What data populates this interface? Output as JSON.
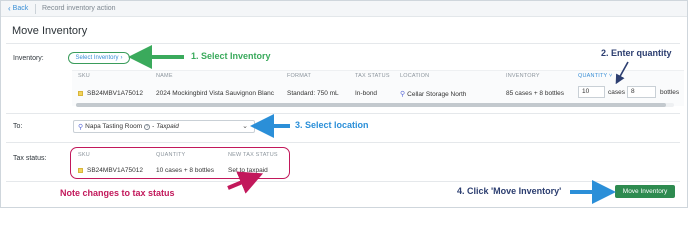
{
  "breadcrumb": {
    "back_label": "Back",
    "current": "Record inventory action"
  },
  "page": {
    "title": "Move Inventory"
  },
  "inventory": {
    "label": "Inventory:",
    "select_button": "Select Inventory",
    "columns": [
      "SKU",
      "NAME",
      "FORMAT",
      "TAX STATUS",
      "LOCATION",
      "INVENTORY",
      "QUANTITY"
    ],
    "row": {
      "sku": "SB24MBV1A75012",
      "name": "2024 Mockingbird Vista Sauvignon Blanc",
      "format": "Standard: 750 mL",
      "tax_status": "In-bond",
      "location": "Cellar Storage North",
      "inventory": "85 cases + 8 bottles",
      "quantity_cases": "10",
      "cases_unit": "cases",
      "quantity_bottles": "8",
      "bottles_unit": "bottles"
    }
  },
  "to": {
    "label": "To:",
    "location_name": "Napa Tasting Room",
    "separator": "-",
    "location_status": "Taxpaid"
  },
  "tax_status": {
    "label": "Tax status:",
    "columns": [
      "SKU",
      "QUANTITY",
      "NEW TAX STATUS"
    ],
    "row": {
      "sku": "SB24MBV1A75012",
      "quantity": "10 cases + 8 bottles",
      "new_status": "Set to taxpaid"
    }
  },
  "actions": {
    "move_button": "Move Inventory"
  },
  "annotations": {
    "step1": "1. Select Inventory",
    "step2": "2. Enter quantity",
    "step3": "3. Select location",
    "step4": "4. Click 'Move Inventory'",
    "note": "Note changes to tax status"
  },
  "colors": {
    "accent_blue": "#3a8fd6",
    "primary_green": "#2e8b50",
    "callout_green": "#3aaa5c",
    "callout_blue": "#2b8fd8",
    "callout_pink": "#c2185b",
    "callout_navy": "#2c3e70"
  },
  "icons": {
    "back": "chevron-left-icon",
    "location": "map-pin-icon",
    "help": "help-circle-icon",
    "dropdown": "chevron-down-icon",
    "sort": "sort-chevron-icon"
  }
}
